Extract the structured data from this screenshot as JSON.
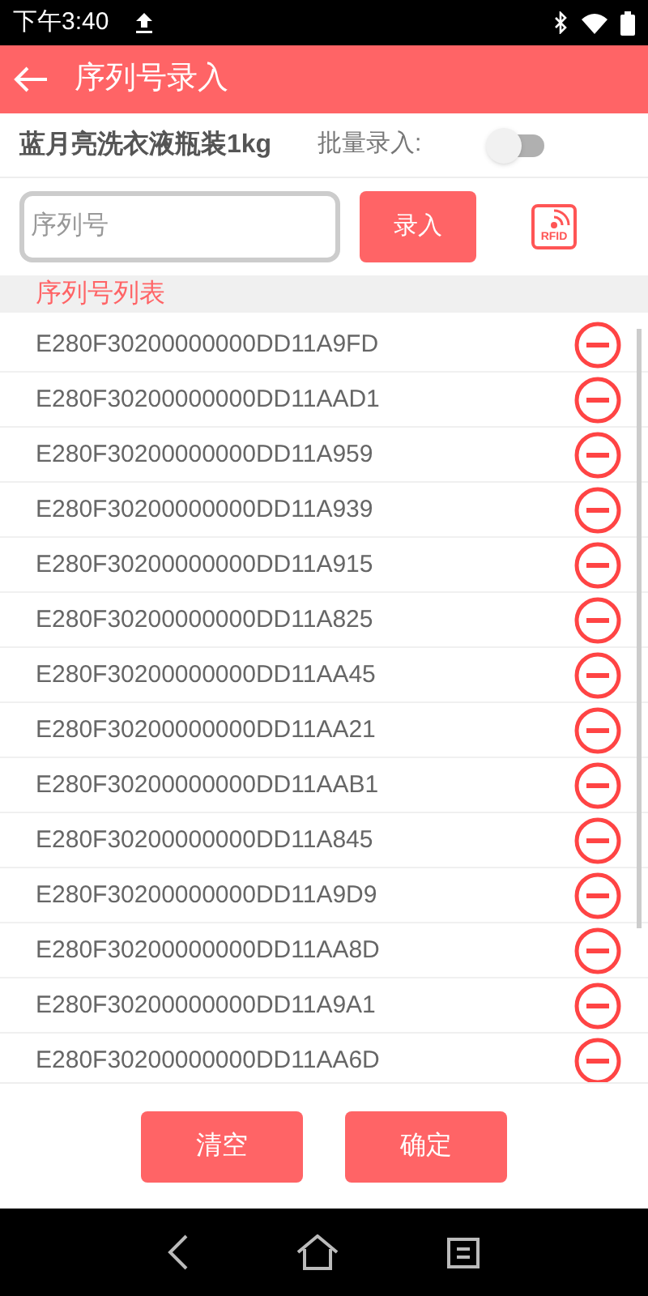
{
  "status_bar": {
    "time": "下午3:40"
  },
  "header": {
    "title": "序列号录入"
  },
  "product": {
    "name": "蓝月亮洗衣液瓶装1kg",
    "batch_label": "批量录入:",
    "batch_on": false
  },
  "entry": {
    "placeholder": "序列号",
    "button": "录入",
    "rfid_label": "RFID"
  },
  "list_title": "序列号列表",
  "serials": [
    "E280F30200000000DD11A9FD",
    "E280F30200000000DD11AAD1",
    "E280F30200000000DD11A959",
    "E280F30200000000DD11A939",
    "E280F30200000000DD11A915",
    "E280F30200000000DD11A825",
    "E280F30200000000DD11AA45",
    "E280F30200000000DD11AA21",
    "E280F30200000000DD11AAB1",
    "E280F30200000000DD11A845",
    "E280F30200000000DD11A9D9",
    "E280F30200000000DD11AA8D",
    "E280F30200000000DD11A9A1",
    "E280F30200000000DD11AA6D"
  ],
  "buttons": [
    "清空",
    "确定"
  ]
}
